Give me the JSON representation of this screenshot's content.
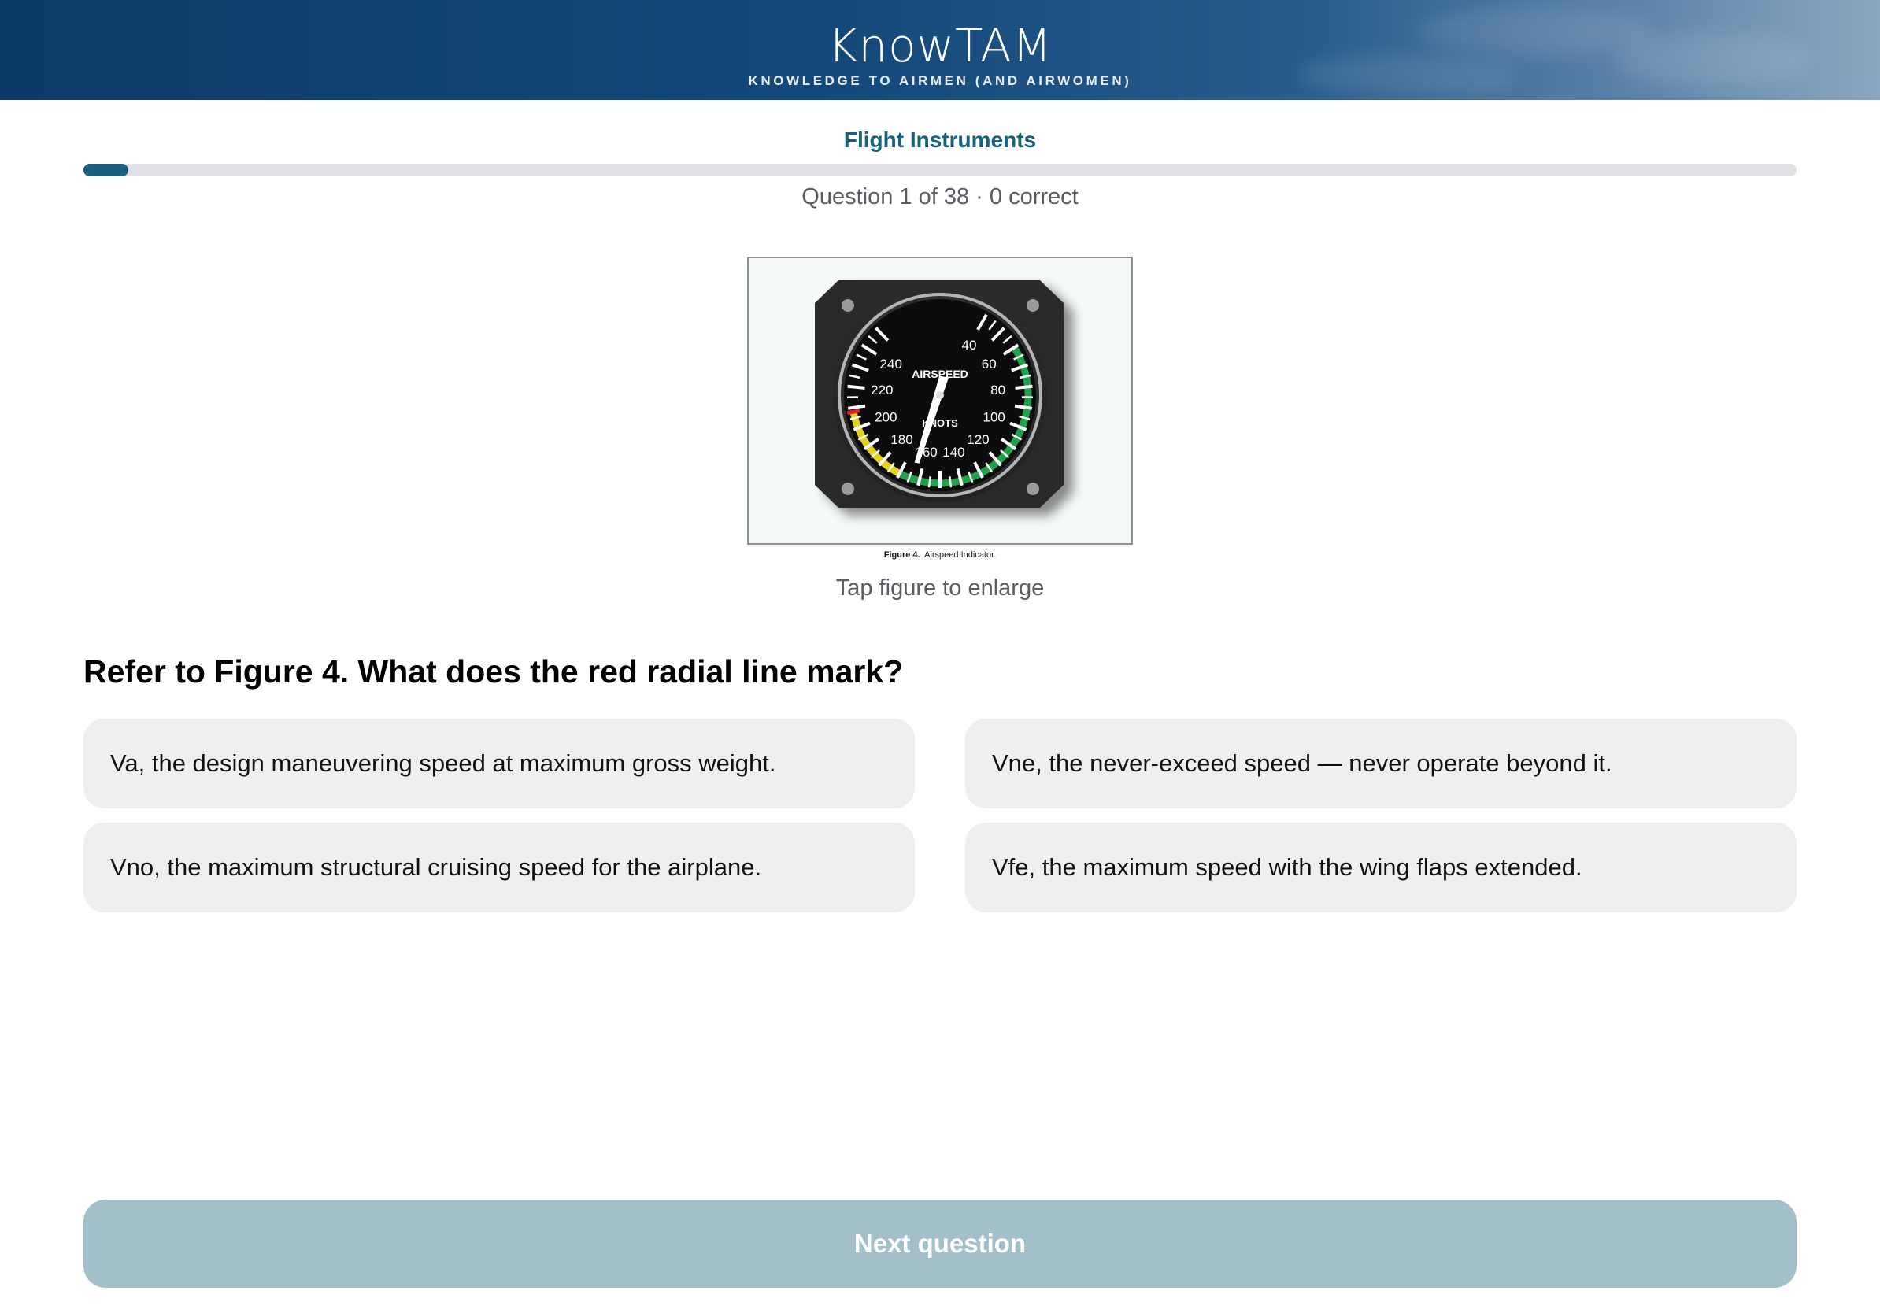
{
  "header": {
    "logo_text": "KnowTAM",
    "tagline": "KNOWLEDGE TO AIRMEN (AND AIRWOMEN)"
  },
  "quiz": {
    "section_title": "Flight Instruments",
    "progress_text": "Question 1 of 38 · 0 correct",
    "progress_fraction": 0.026,
    "question": "Refer to Figure 4. What does the red radial line mark?"
  },
  "figure": {
    "caption_label": "Figure 4.",
    "caption_text": "Airspeed Indicator.",
    "hint": "Tap figure to enlarge",
    "dial_title": "AIRSPEED",
    "dial_unit": "KNOTS",
    "dial_numbers": [
      "40",
      "60",
      "80",
      "100",
      "120",
      "140",
      "160",
      "180",
      "200",
      "220",
      "240"
    ]
  },
  "answers": [
    {
      "label": "Va, the design maneuvering speed at maximum gross weight."
    },
    {
      "label": "Vne, the never-exceed speed — never operate beyond it."
    },
    {
      "label": "Vno, the maximum structural cruising speed for the airplane."
    },
    {
      "label": "Vfe, the maximum speed with the wing flaps extended."
    }
  ],
  "footer": {
    "next_label": "Next question"
  },
  "colors": {
    "header_bg": "#0d3a66",
    "accent": "#15617e",
    "progress_fill": "#1a5f7d",
    "answer_bg": "#efeff1",
    "button_disabled": "#a3bfc9"
  }
}
